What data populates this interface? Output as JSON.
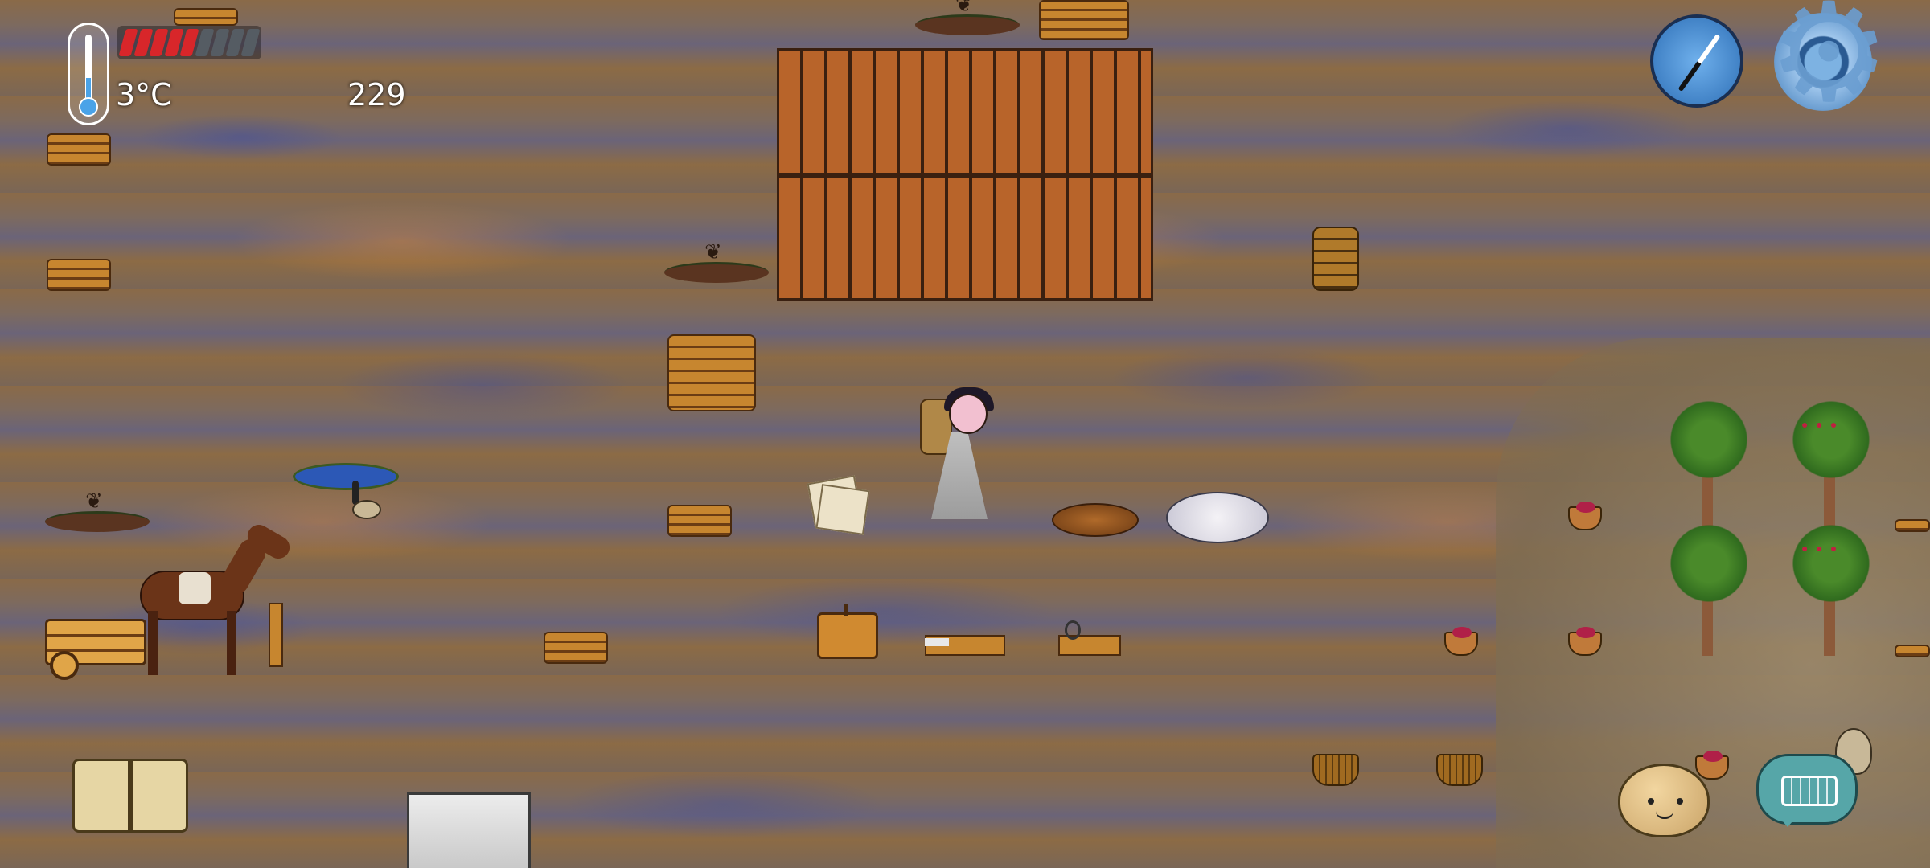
{
  "hud": {
    "temperature": "3°C",
    "counter": "229",
    "health": {
      "filled": 5,
      "total": 9
    }
  },
  "colors": {
    "health_full": "#d8262a",
    "health_empty": "#555c63",
    "hud_text": "#ffffff",
    "compass": "#4a8fd8",
    "keyboard_bubble": "#56a6a8"
  },
  "icons": {
    "thermometer": "thermometer-icon",
    "compass": "compass-icon",
    "settings": "gear-icon",
    "recipe_book": "book-icon",
    "emote": "potato-face-icon",
    "chat": "keyboard-bubble-icon"
  }
}
